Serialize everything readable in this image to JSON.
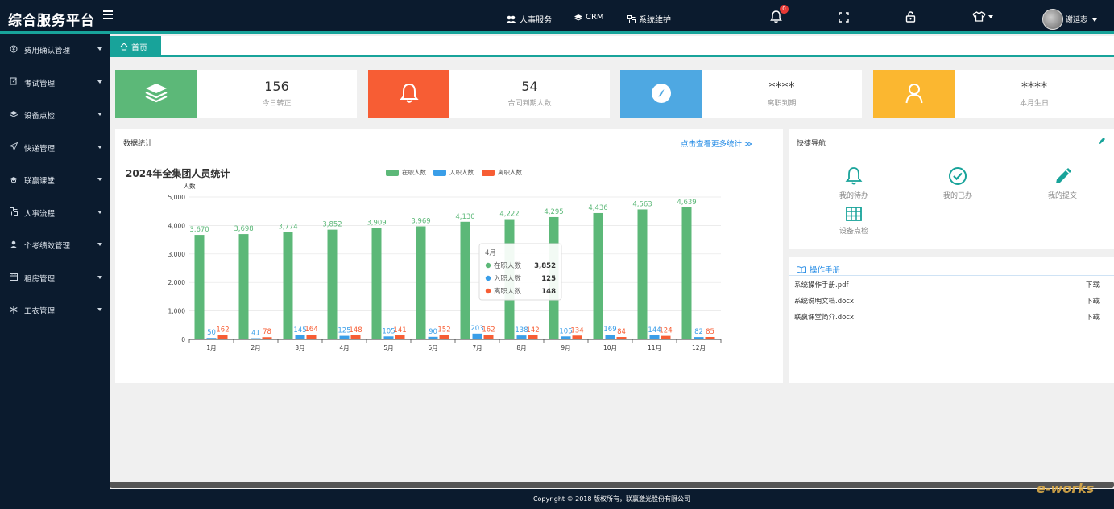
{
  "app": {
    "title": "综合服务平台"
  },
  "topnav": {
    "links": [
      {
        "label": "人事服务",
        "icon": "users-icon"
      },
      {
        "label": "CRM",
        "icon": "layers-icon"
      },
      {
        "label": "系统维护",
        "icon": "settings-icon"
      }
    ],
    "notification_count": "0",
    "user_name": "谢延志"
  },
  "sidebar": {
    "items": [
      {
        "label": "费用确认管理",
        "icon": "coin-icon"
      },
      {
        "label": "考试管理",
        "icon": "edit-icon"
      },
      {
        "label": "设备点检",
        "icon": "layers-icon"
      },
      {
        "label": "快递管理",
        "icon": "send-icon"
      },
      {
        "label": "联赢课堂",
        "icon": "graduation-icon"
      },
      {
        "label": "人事流程",
        "icon": "flow-icon"
      },
      {
        "label": "个考绩效管理",
        "icon": "user-icon"
      },
      {
        "label": "租房管理",
        "icon": "calendar-icon"
      },
      {
        "label": "工衣管理",
        "icon": "snowflake-icon"
      }
    ]
  },
  "tabs": {
    "home": "首页"
  },
  "stats": [
    {
      "value": "156",
      "label": "今日转正",
      "color": "#5cb878",
      "icon": "layers-icon"
    },
    {
      "value": "54",
      "label": "合同到期人数",
      "color": "#f75d34",
      "icon": "bell-icon"
    },
    {
      "value": "****",
      "label": "离职到期",
      "color": "#4ea8e2",
      "icon": "compass-icon"
    },
    {
      "value": "****",
      "label": "本月生日",
      "color": "#fbb730",
      "icon": "user-icon"
    }
  ],
  "stats_panel": {
    "title": "数据统计",
    "more_link": "点击查看更多统计 ≫"
  },
  "chart_data": {
    "type": "bar",
    "title": "2024年全集团人员统计",
    "ylabel": "人数",
    "ylim": [
      0,
      5000
    ],
    "yticks": [
      "0",
      "1,000",
      "2,000",
      "3,000",
      "4,000",
      "5,000"
    ],
    "categories": [
      "1月",
      "2月",
      "3月",
      "4月",
      "5月",
      "6月",
      "7月",
      "8月",
      "9月",
      "10月",
      "11月",
      "12月"
    ],
    "series": [
      {
        "name": "在职人数",
        "color": "#5cb878",
        "values": [
          3670,
          3698,
          3774,
          3852,
          3909,
          3969,
          4130,
          4222,
          4295,
          4436,
          4563,
          4639
        ],
        "labels": [
          "3,670",
          "3,698",
          "3,774",
          "3,852",
          "3,909",
          "3,969",
          "4,130",
          "4,222",
          "4,295",
          "4,436",
          "4,563",
          "4,639"
        ]
      },
      {
        "name": "入职人数",
        "color": "#3a9ee8",
        "values": [
          50,
          41,
          145,
          125,
          105,
          90,
          203,
          138,
          105,
          169,
          144,
          82
        ],
        "labels": [
          "50",
          "41",
          "145",
          "125",
          "105",
          "90",
          "203",
          "138",
          "105",
          "169",
          "144",
          "82"
        ]
      },
      {
        "name": "离职人数",
        "color": "#f75d34",
        "values": [
          162,
          78,
          164,
          148,
          141,
          152,
          162,
          142,
          134,
          84,
          124,
          85
        ],
        "labels": [
          "162",
          "78",
          "164",
          "148",
          "141",
          "152",
          "162",
          "142",
          "134",
          "84",
          "124",
          "85"
        ]
      }
    ],
    "tooltip": {
      "title": "4月",
      "rows": [
        {
          "name": "在职人数",
          "value": "3,852",
          "color": "#5cb878"
        },
        {
          "name": "入职人数",
          "value": "125",
          "color": "#3a9ee8"
        },
        {
          "name": "离职人数",
          "value": "148",
          "color": "#f75d34"
        }
      ]
    }
  },
  "quick_nav": {
    "title": "快捷导航",
    "items": [
      {
        "label": "我的待办",
        "icon": "bell-icon"
      },
      {
        "label": "我的已办",
        "icon": "check-circle-icon"
      },
      {
        "label": "我的提交",
        "icon": "pencil-icon"
      },
      {
        "label": "设备点检",
        "icon": "table-icon"
      }
    ]
  },
  "manual": {
    "title": "操作手册",
    "docs": [
      {
        "name": "系统操作手册.pdf",
        "action": "下载"
      },
      {
        "name": "系统说明文档.docx",
        "action": "下载"
      },
      {
        "name": "联赢课堂简介.docx",
        "action": "下载"
      }
    ]
  },
  "footer": {
    "text": "Copyright © 2018    版权所有，联赢激光股份有限公司"
  },
  "watermark": "e-works"
}
